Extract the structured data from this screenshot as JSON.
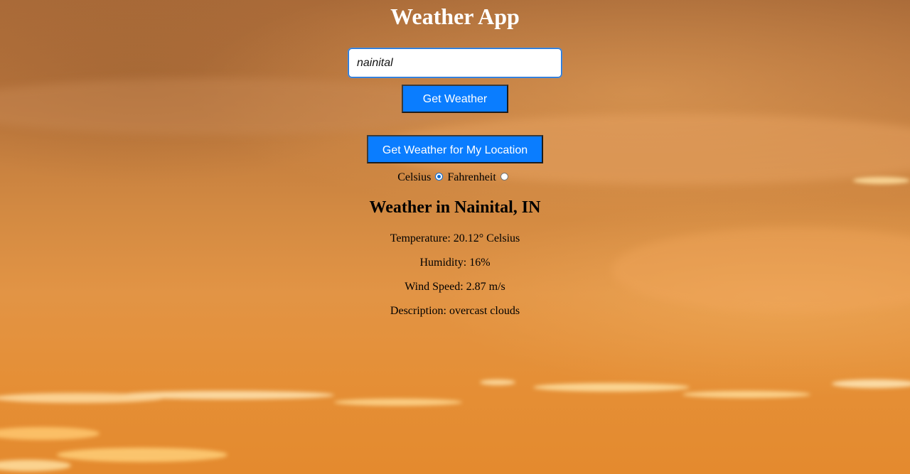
{
  "app": {
    "title": "Weather App"
  },
  "search": {
    "value": "nainital",
    "button_label": "Get Weather"
  },
  "location_button_label": "Get Weather for My Location",
  "units": {
    "celsius_label": "Celsius",
    "fahrenheit_label": "Fahrenheit",
    "selected": "Celsius"
  },
  "result": {
    "heading": "Weather in Nainital, IN",
    "temperature": "Temperature: 20.12° Celsius",
    "humidity": "Humidity: 16%",
    "wind_speed": "Wind Speed: 2.87 m/s",
    "description": "Description: overcast clouds"
  },
  "colors": {
    "button": "#0a7dff",
    "title": "#ffffff",
    "sky_top": "#a96a38",
    "sky_bottom": "#e48a2e"
  }
}
